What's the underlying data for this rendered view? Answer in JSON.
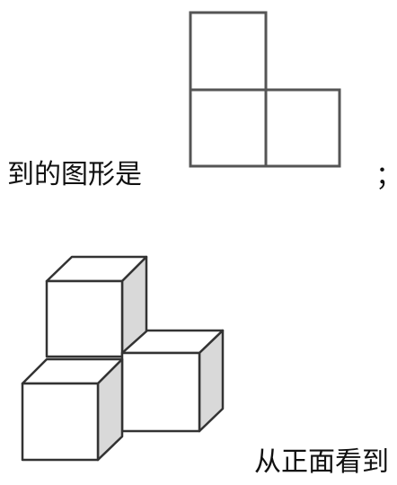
{
  "text_line1": "到的图形是",
  "text_semicolon": "；",
  "text_line2": "从正面看到",
  "colors": {
    "stroke": "#333333",
    "side_face": "#d9d9d9",
    "top_face": "#ffffff",
    "front_face": "#ffffff"
  }
}
